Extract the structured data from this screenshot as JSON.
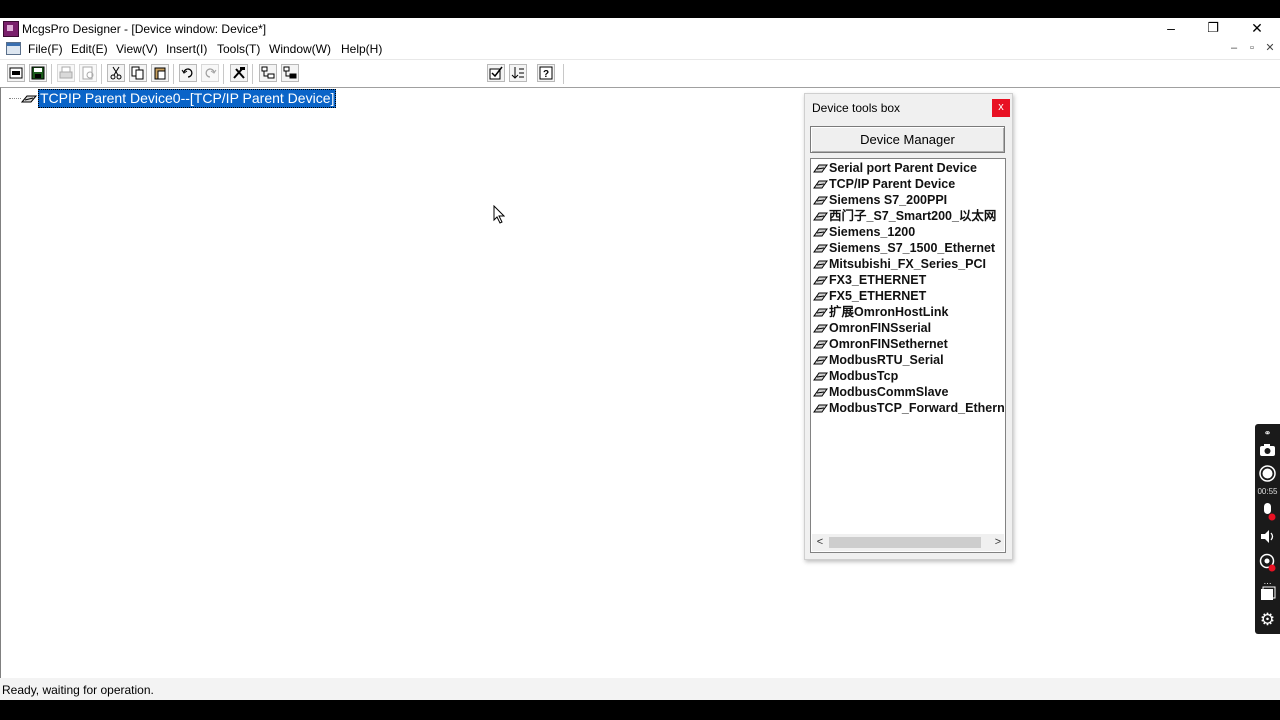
{
  "window": {
    "title": "McgsPro Designer - [Device window: Device*]",
    "controls": {
      "minimize": "–",
      "restore": "❐",
      "close": "✕"
    },
    "mdi_controls": {
      "minimize": "–",
      "restore": "▫",
      "close": "✕"
    }
  },
  "menubar": {
    "items": [
      "File(F)",
      "Edit(E)",
      "View(V)",
      "Insert(I)",
      "Tools(T)",
      "Window(W)",
      "Help(H)"
    ]
  },
  "toolbar": {
    "buttons": [
      "new-icon",
      "save-icon",
      "print-icon",
      "print-preview-icon",
      "cut-icon",
      "copy-icon",
      "paste-icon",
      "undo-icon",
      "redo-icon",
      "tools-icon",
      "tree-expand-icon",
      "tree-collapse-icon",
      "check-icon",
      "sort-icon",
      "help-icon"
    ]
  },
  "tree": {
    "selected_node": "TCPIP Parent Device0--[TCP/IP Parent Device]"
  },
  "device_tools_box": {
    "title": "Device tools box",
    "close_label": "x",
    "manager_button": "Device Manager",
    "devices": [
      "Serial port Parent Device",
      "TCP/IP Parent Device",
      "Siemens S7_200PPI",
      "西门子_S7_Smart200_以太网",
      "Siemens_1200",
      "Siemens_S7_1500_Ethernet",
      "Mitsubishi_FX_Series_PCI",
      "FX3_ETHERNET",
      "FX5_ETHERNET",
      "扩展OmronHostLink",
      "OmronFINSserial",
      "OmronFINSethernet",
      "ModbusRTU_Serial",
      "ModbusTcp",
      "ModbusCommSlave",
      "ModbusTCP_Forward_Ethernet"
    ],
    "scroll_left": "<",
    "scroll_right": ">"
  },
  "recorder": {
    "time": "00:55",
    "icons": [
      "link-icon",
      "camera-icon",
      "record-icon",
      "mic-muted-icon",
      "speaker-icon",
      "webcam-muted-icon",
      "window-icon",
      "settings-icon"
    ]
  },
  "statusbar": {
    "text": "Ready, waiting for operation."
  }
}
